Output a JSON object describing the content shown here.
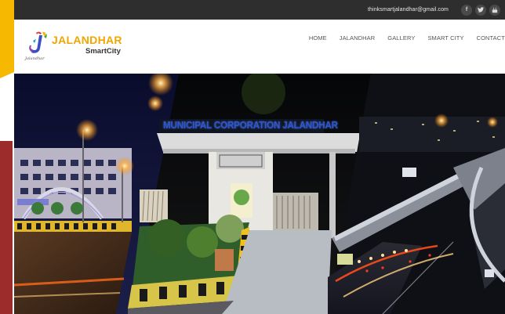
{
  "topbar": {
    "email": "thinksmartjalandhar@gmail.com",
    "social": [
      {
        "icon": "facebook-icon",
        "glyph": "f"
      },
      {
        "icon": "twitter-icon",
        "glyph": "𝕥"
      },
      {
        "icon": "youtube-icon",
        "glyph": "▶"
      }
    ]
  },
  "header": {
    "logo_title": "JALANDHAR",
    "logo_subtitle": "SmartCity",
    "logo_small": "Jalandhar",
    "nav": [
      "HOME",
      "JALANDHAR",
      "GALLERY",
      "SMART CITY",
      "CONTACT"
    ]
  },
  "hero": {
    "sign_text": "MUNICIPAL CORPORATION JALANDHAR"
  },
  "colors": {
    "accent_yellow": "#f6b800",
    "accent_red": "#9c2b2b",
    "topbar": "#2e2e2e",
    "logo_orange": "#f0a500"
  }
}
